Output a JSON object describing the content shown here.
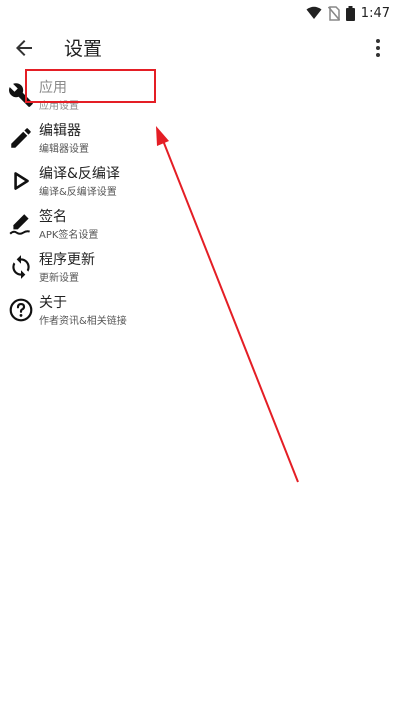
{
  "status_bar": {
    "time": "1:47"
  },
  "app_bar": {
    "title": "设置"
  },
  "settings_items": [
    {
      "title": "应用",
      "subtitle": "应用设置",
      "icon": "wrench-icon"
    },
    {
      "title": "编辑器",
      "subtitle": "编辑器设置",
      "icon": "pencil-icon"
    },
    {
      "title": "编译&反编译",
      "subtitle": "编译&反编译设置",
      "icon": "play-icon"
    },
    {
      "title": "签名",
      "subtitle": "APK签名设置",
      "icon": "signature-icon"
    },
    {
      "title": "程序更新",
      "subtitle": "更新设置",
      "icon": "sync-icon"
    },
    {
      "title": "关于",
      "subtitle": "作者资讯&相关链接",
      "icon": "help-circle-icon"
    }
  ],
  "annotation": {
    "color": "#e41e25"
  }
}
